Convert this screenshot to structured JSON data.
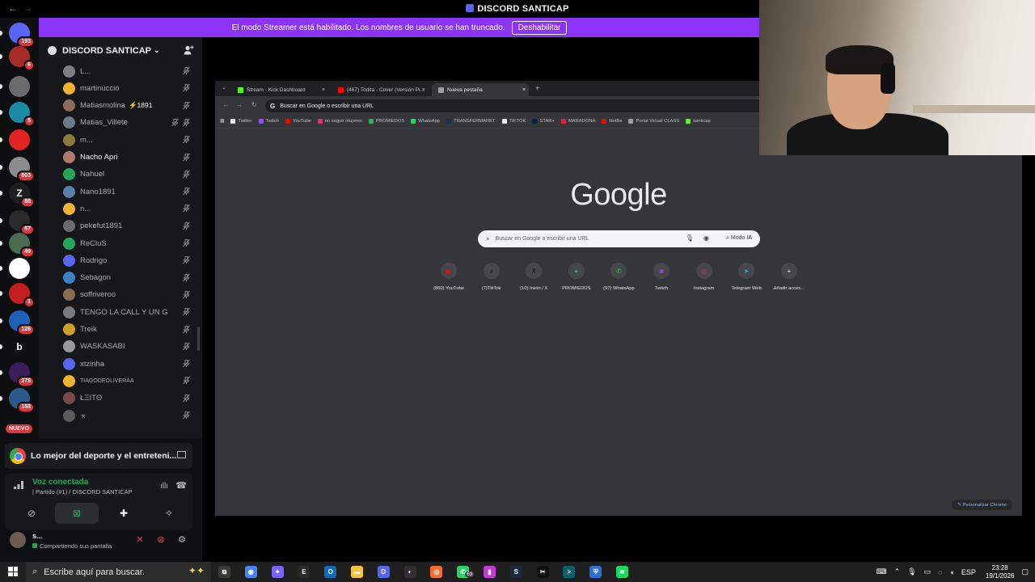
{
  "title_bar": {
    "app_title": "DISCORD SANTICAP",
    "back_glyph": "←",
    "forward_glyph": "→"
  },
  "streamer_banner": {
    "message": "El modo Streamer está habilitado. Los nombres de usuario se han truncado.",
    "button_label": "Deshabilitar",
    "color": "#8c34f5"
  },
  "server_rail": {
    "servers": [
      {
        "badge": "193",
        "color": "#5865f2",
        "text": ""
      },
      {
        "badge": "6",
        "color": "#a62c2b",
        "text": ""
      },
      {
        "badge": "",
        "color": "#6b6b6b",
        "text": ""
      },
      {
        "badge": "5",
        "color": "#1c8ca6",
        "text": ""
      },
      {
        "badge": "",
        "color": "#e02323",
        "text": ""
      },
      {
        "badge": "803",
        "color": "#8c8c8c",
        "text": ""
      },
      {
        "badge": "88",
        "color": "#1e1e1e",
        "text": "Z"
      },
      {
        "badge": "57",
        "color": "#2a2a2a",
        "text": ""
      },
      {
        "badge": "49",
        "color": "#4a6b4f",
        "text": ""
      },
      {
        "badge": "",
        "color": "#ffffff",
        "text": ""
      },
      {
        "badge": "1",
        "color": "#c41f1f",
        "text": ""
      },
      {
        "badge": "126",
        "color": "#1e63b5",
        "text": ""
      },
      {
        "badge": "",
        "color": "#0e0f11",
        "text": "b"
      },
      {
        "badge": "278",
        "color": "#3a1f5c",
        "text": ""
      },
      {
        "badge": "158",
        "color": "#2b5a8a",
        "text": ""
      }
    ],
    "new_label": "NUEVO"
  },
  "sidebar": {
    "server_name": "DISCORD SANTICAP",
    "members": [
      {
        "name": "L...",
        "tag": "",
        "avatar_color": "#7a7f86",
        "hover": false,
        "extra_icon": false
      },
      {
        "name": "martinuccio",
        "tag": "",
        "avatar_color": "#f0b232",
        "hover": false,
        "extra_icon": false
      },
      {
        "name": "Matiasmolina",
        "tag": "⚡1891",
        "avatar_color": "#8e6b5c",
        "hover": false,
        "extra_icon": false
      },
      {
        "name": "Matias_Villete",
        "tag": "",
        "avatar_color": "#6e7a86",
        "hover": false,
        "extra_icon": true
      },
      {
        "name": "m...",
        "tag": "",
        "avatar_color": "#8a7a3c",
        "hover": false,
        "extra_icon": false
      },
      {
        "name": "Nacho Apri",
        "tag": "",
        "avatar_color": "#b07a6a",
        "hover": true,
        "extra_icon": false
      },
      {
        "name": "Nahuel",
        "tag": "",
        "avatar_color": "#23a55a",
        "hover": false,
        "extra_icon": false
      },
      {
        "name": "Nano1891",
        "tag": "",
        "avatar_color": "#5a7fa8",
        "hover": false,
        "extra_icon": false
      },
      {
        "name": "n...",
        "tag": "",
        "avatar_color": "#f0b232",
        "hover": false,
        "extra_icon": false
      },
      {
        "name": "pekefut1891",
        "tag": "",
        "avatar_color": "#6b6b6b",
        "hover": false,
        "extra_icon": false
      },
      {
        "name": "ReCluS",
        "tag": "",
        "avatar_color": "#23a55a",
        "hover": false,
        "extra_icon": false
      },
      {
        "name": "Rodrigo",
        "tag": "",
        "avatar_color": "#5865f2",
        "hover": false,
        "extra_icon": false
      },
      {
        "name": "Sebagon",
        "tag": "",
        "avatar_color": "#3b82c4",
        "hover": false,
        "extra_icon": false
      },
      {
        "name": "soffriveroo",
        "tag": "",
        "avatar_color": "#8a6c52",
        "hover": false,
        "extra_icon": false
      },
      {
        "name": "TENGO LA CALL Y UN G",
        "tag": "",
        "avatar_color": "#7a7a7a",
        "hover": false,
        "extra_icon": false
      },
      {
        "name": "Treik",
        "tag": "",
        "avatar_color": "#c9a227",
        "hover": false,
        "extra_icon": false
      },
      {
        "name": "WASKASABI",
        "tag": "",
        "avatar_color": "#9a9a9a",
        "hover": false,
        "extra_icon": false
      },
      {
        "name": "xtzinha",
        "tag": "",
        "avatar_color": "#5865f2",
        "hover": false,
        "extra_icon": false
      },
      {
        "name": "TIAGODEOLIVERAA",
        "tag": "",
        "avatar_color": "#f0b232",
        "hover": false,
        "extra_icon": false
      },
      {
        "name": "ŁΞITΘ",
        "tag": "",
        "avatar_color": "#7a4a4a",
        "hover": false,
        "extra_icon": false
      },
      {
        "name": "⌅",
        "tag": "",
        "avatar_color": "#5a5a5a",
        "hover": false,
        "extra_icon": false
      }
    ]
  },
  "bottom_panel": {
    "activity_title": "Lo mejor del deporte y el entreteni...",
    "voice_status": "Voz conectada",
    "voice_channel": "| Partido (#1) / DISCORD SANTICAP",
    "user_name": "s...",
    "user_status": "Compartiendo sus pantalla"
  },
  "shared_screen": {
    "tabs": [
      {
        "label": "Stream - Kick Dashboard",
        "fav_color": "#53fc18",
        "active": false
      },
      {
        "label": "(467) Todita - Cover (Versión Pi...",
        "fav_color": "#ff0000",
        "active": false
      },
      {
        "label": "Nueva pestaña",
        "fav_color": "#9aa0a6",
        "active": true
      }
    ],
    "omnibox_text": "Buscar en Google o escribir una URL",
    "bookmarks": [
      {
        "label": "Twitter",
        "color": "#e8eaed"
      },
      {
        "label": "Twitch",
        "color": "#9146ff"
      },
      {
        "label": "YouTube",
        "color": "#ff0000"
      },
      {
        "label": "no seguir mujeres",
        "color": "#e1306c"
      },
      {
        "label": "PROMIEDOS",
        "color": "#3ba55c"
      },
      {
        "label": "WhatsApp",
        "color": "#25d366"
      },
      {
        "label": "TRANSFERMARKT",
        "color": "#1a3151"
      },
      {
        "label": "TIKTOK",
        "color": "#e8eaed"
      },
      {
        "label": "STAR+",
        "color": "#0a1f4d"
      },
      {
        "label": "MARADONA",
        "color": "#e8174a"
      },
      {
        "label": "Netflix",
        "color": "#e50914"
      },
      {
        "label": "Portal Virtual CLASS",
        "color": "#9aa0a6"
      },
      {
        "label": "santicap",
        "color": "#53fc18"
      }
    ],
    "logo_text": "Google",
    "search_placeholder": "Buscar en Google o escribir una URL",
    "ai_mode_label": "Modo IA",
    "shortcuts": [
      {
        "label": "(860) YouTube",
        "icon": "▶",
        "color": "#ff0000"
      },
      {
        "label": "(7)TikTok",
        "icon": "♪",
        "color": "#111111"
      },
      {
        "label": "(10) Inicio / X",
        "icon": "X",
        "color": "#111111"
      },
      {
        "label": "PROMIEDOS",
        "icon": "●",
        "color": "#3ba55c"
      },
      {
        "label": "(97) WhatsApp",
        "icon": "✆",
        "color": "#25d366"
      },
      {
        "label": "Twitch",
        "icon": "◙",
        "color": "#9146ff"
      },
      {
        "label": "Instagram",
        "icon": "◎",
        "color": "#e1306c"
      },
      {
        "label": "Telegram Web",
        "icon": "➤",
        "color": "#2aabee"
      },
      {
        "label": "Añadir acces...",
        "icon": "+",
        "color": "#46474b"
      }
    ],
    "customize_label": "✎ Personalizar Chrome"
  },
  "taskbar": {
    "search_placeholder": "Escribe aquí para buscar.",
    "apps": [
      {
        "name": "task-view",
        "color": "#3a3a3a",
        "glyph": "⧉",
        "badge": ""
      },
      {
        "name": "chrome",
        "color": "#4285f4",
        "glyph": "◉",
        "badge": ""
      },
      {
        "name": "copilot",
        "color": "#7b61ff",
        "glyph": "✦",
        "badge": ""
      },
      {
        "name": "epic",
        "color": "#2a2a2a",
        "glyph": "E",
        "badge": ""
      },
      {
        "name": "outlook",
        "color": "#0f6cbd",
        "glyph": "O",
        "badge": ""
      },
      {
        "name": "explorer",
        "color": "#f4c542",
        "glyph": "▬",
        "badge": ""
      },
      {
        "name": "discord",
        "color": "#5865f2",
        "glyph": "D",
        "badge": ""
      },
      {
        "name": "obs",
        "color": "#302e31",
        "glyph": "◐",
        "badge": ""
      },
      {
        "name": "origin",
        "color": "#f56c2d",
        "glyph": "◎",
        "badge": ""
      },
      {
        "name": "whatsapp",
        "color": "#25d366",
        "glyph": "✆",
        "badge": "63"
      },
      {
        "name": "app-pink",
        "color": "#c43bd6",
        "glyph": "▮",
        "badge": ""
      },
      {
        "name": "steam",
        "color": "#1b2838",
        "glyph": "S",
        "badge": ""
      },
      {
        "name": "capcut",
        "color": "#111111",
        "glyph": "✂",
        "badge": ""
      },
      {
        "name": "terminal",
        "color": "#0b5f6b",
        "glyph": ">",
        "badge": ""
      },
      {
        "name": "vpn",
        "color": "#2a6fd6",
        "glyph": "⛨",
        "badge": ""
      },
      {
        "name": "spotify",
        "color": "#1ed760",
        "glyph": "≋",
        "badge": ""
      }
    ],
    "language": "ESP",
    "time": "23:28",
    "date": "19/1/2026"
  }
}
